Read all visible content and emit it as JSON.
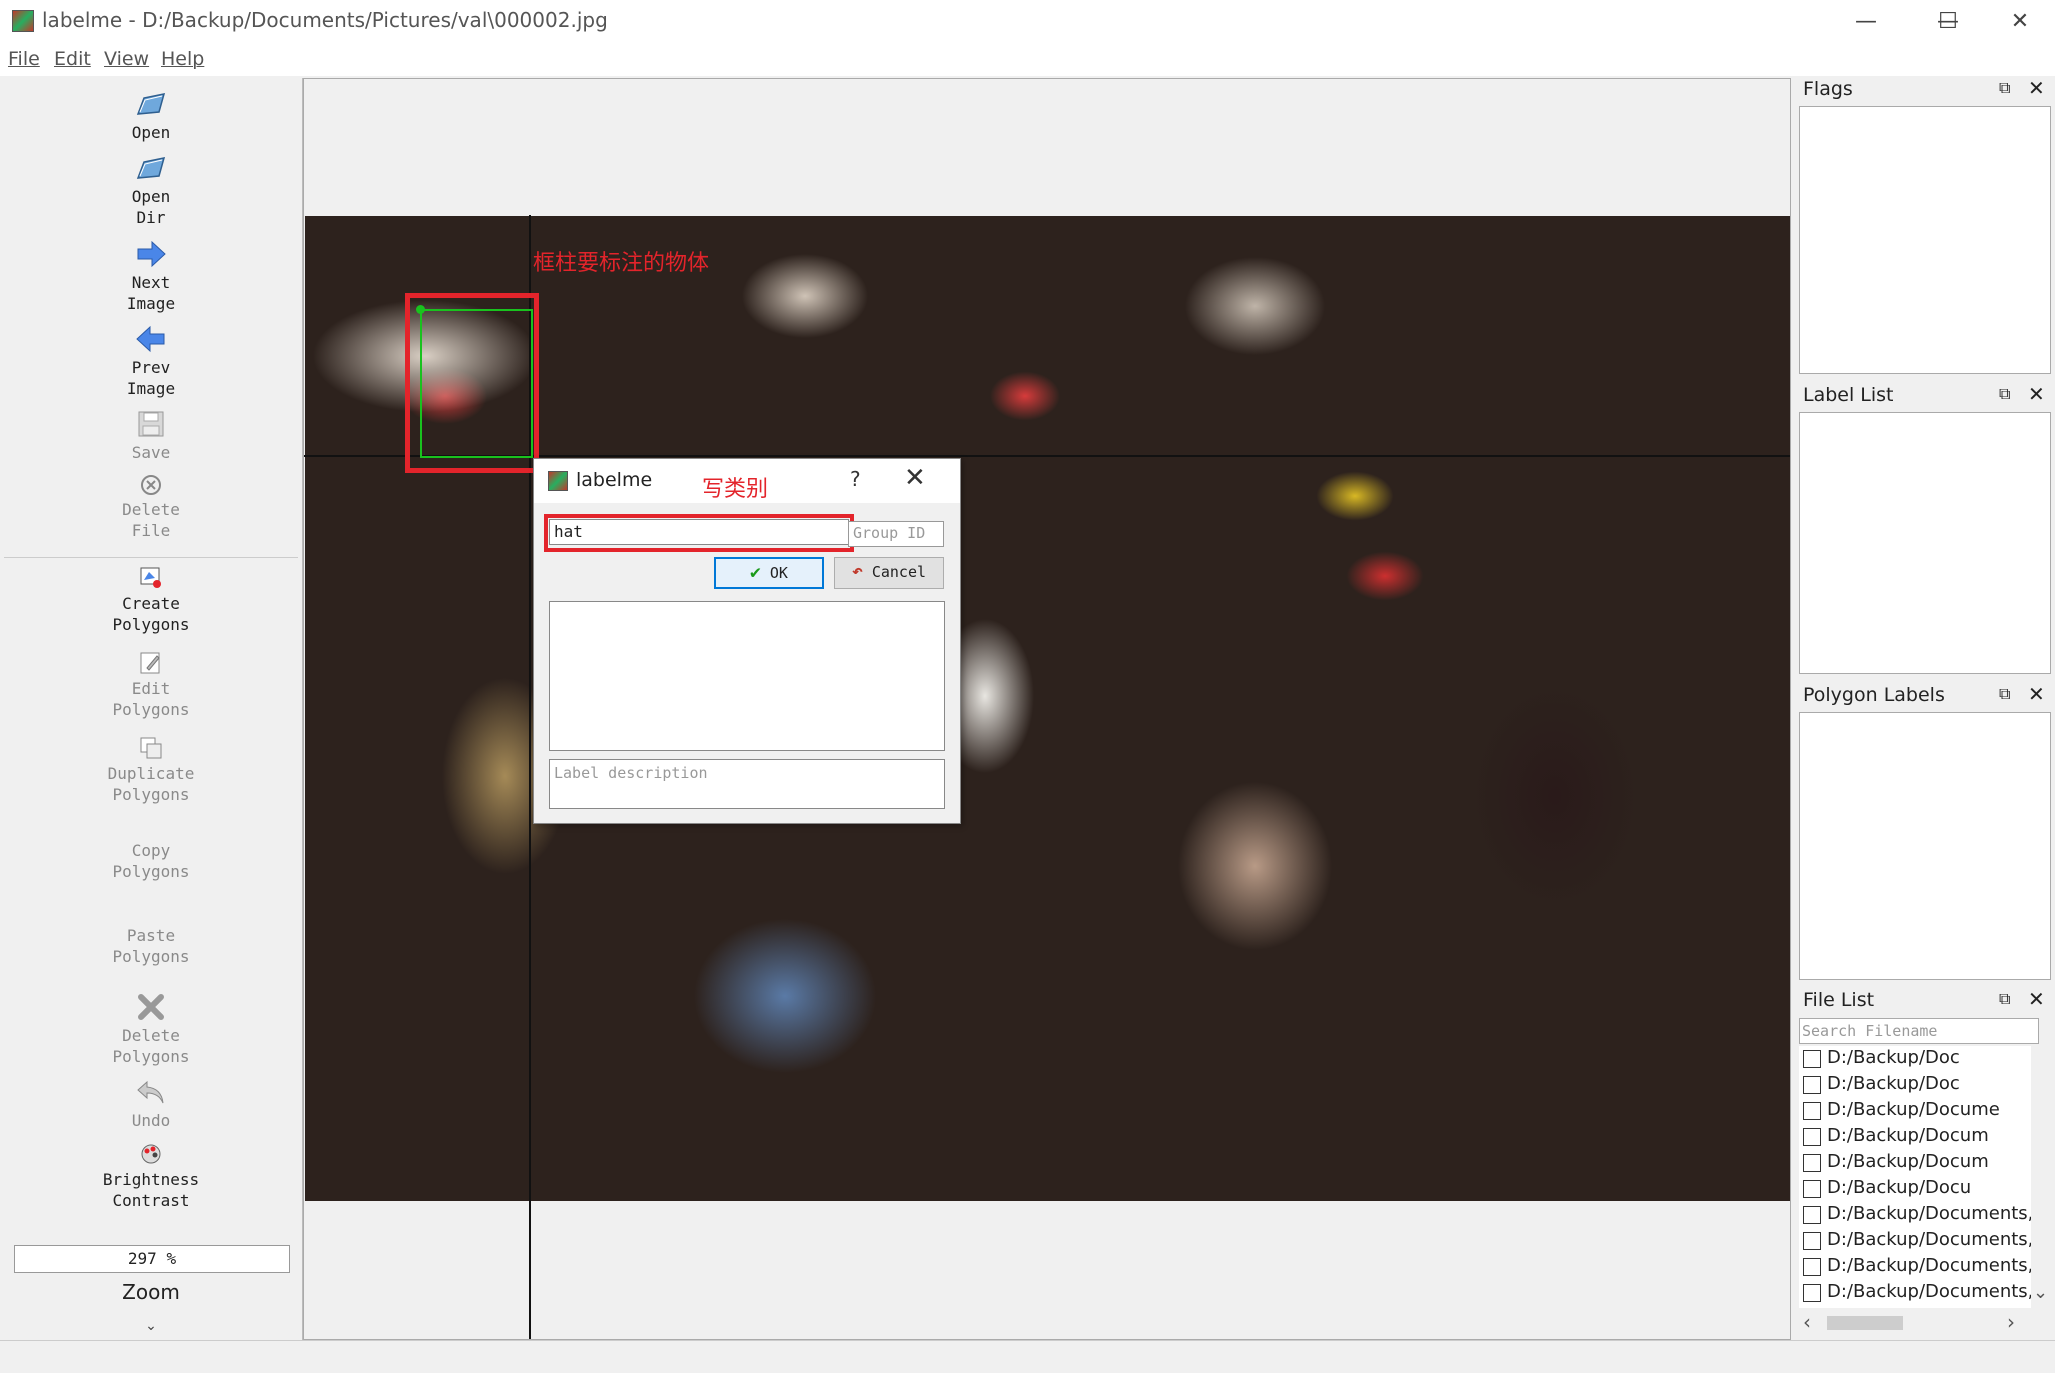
{
  "window": {
    "title": "labelme - D:/Backup/Documents/Pictures/val\\000002.jpg",
    "minimize": "—",
    "maximize": "☐",
    "close": "✕"
  },
  "menu": [
    "File",
    "Edit",
    "View",
    "Help"
  ],
  "toolbar": {
    "open": "Open",
    "open_dir": [
      "Open",
      "Dir"
    ],
    "next_image": [
      "Next",
      "Image"
    ],
    "prev_image": [
      "Prev",
      "Image"
    ],
    "save": "Save",
    "delete_file": [
      "Delete",
      "File"
    ],
    "create_polygons": [
      "Create",
      "Polygons"
    ],
    "edit_polygons": [
      "Edit",
      "Polygons"
    ],
    "duplicate_polygons": [
      "Duplicate",
      "Polygons"
    ],
    "copy_polygons": [
      "Copy",
      "Polygons"
    ],
    "paste_polygons": [
      "Paste",
      "Polygons"
    ],
    "delete_polygons": [
      "Delete",
      "Polygons"
    ],
    "undo": "Undo",
    "brightness_contrast": [
      "Brightness",
      "Contrast"
    ],
    "zoom_value": "297 %",
    "zoom_label": "Zoom",
    "more": "⌄"
  },
  "canvas": {
    "annotation_text": "框柱要标注的物体"
  },
  "dialog": {
    "title": "labelme",
    "annotation_text": "写类别",
    "help": "?",
    "close": "✕",
    "label_value": "hat",
    "group_id_placeholder": "Group ID",
    "ok": "OK",
    "cancel": "Cancel",
    "description_placeholder": "Label description"
  },
  "docks": {
    "flags": "Flags",
    "label_list": "Label List",
    "polygon_labels": "Polygon Labels",
    "file_list": "File List",
    "float_icon": "⧉",
    "close_icon": "✕"
  },
  "file_list": {
    "search_placeholder": "Search Filename",
    "items": [
      "D:/Backup/Doc",
      "D:/Backup/Doc",
      "D:/Backup/Docume",
      "D:/Backup/Docum",
      "D:/Backup/Docum",
      "D:/Backup/Docu",
      "D:/Backup/Documents,",
      "D:/Backup/Documents,",
      "D:/Backup/Documents,",
      "D:/Backup/Documents,"
    ],
    "scroll_down": "⌄",
    "scroll_left": "‹",
    "scroll_right": "›"
  },
  "colors": {
    "annotation_red": "#e3242b",
    "polygon_green": "#19c21e",
    "ok_border": "#0078d7"
  }
}
